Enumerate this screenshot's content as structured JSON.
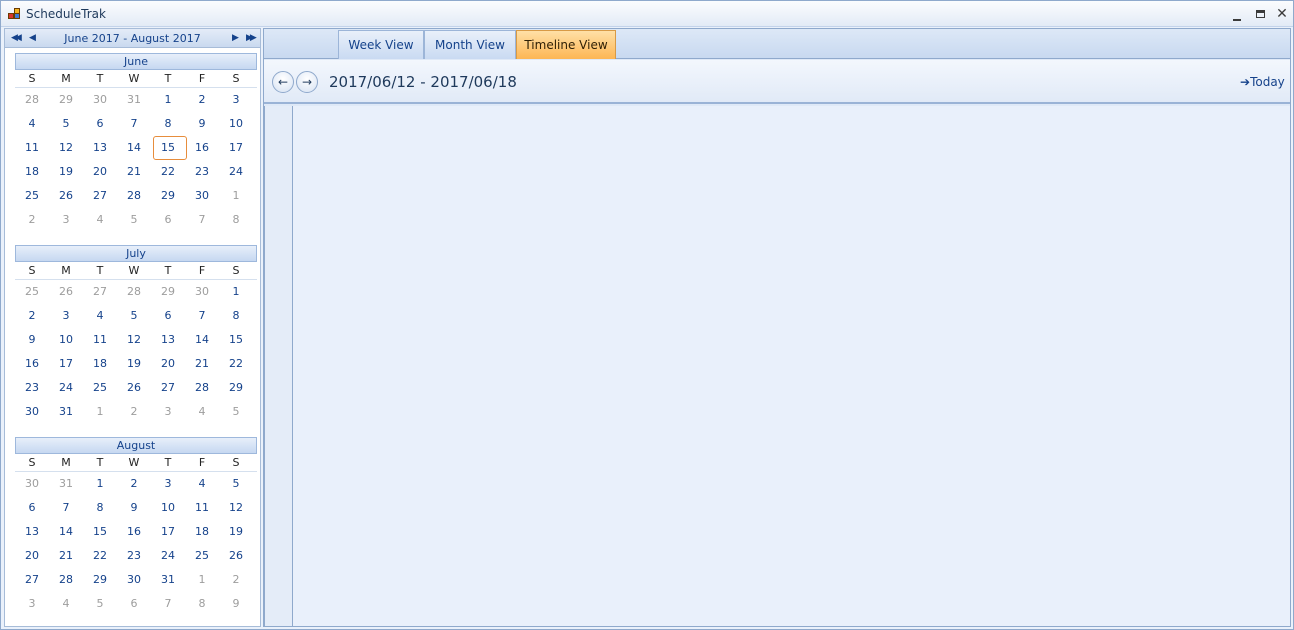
{
  "window": {
    "title": "ScheduleTrak"
  },
  "navigator": {
    "range_label": "June 2017 - August 2017",
    "weekdays": [
      "S",
      "M",
      "T",
      "W",
      "T",
      "F",
      "S"
    ],
    "months": [
      {
        "name": "June",
        "weeks": [
          [
            {
              "d": "28",
              "o": true
            },
            {
              "d": "29",
              "o": true
            },
            {
              "d": "30",
              "o": true
            },
            {
              "d": "31",
              "o": true
            },
            {
              "d": "1"
            },
            {
              "d": "2"
            },
            {
              "d": "3"
            }
          ],
          [
            {
              "d": "4"
            },
            {
              "d": "5"
            },
            {
              "d": "6"
            },
            {
              "d": "7"
            },
            {
              "d": "8"
            },
            {
              "d": "9"
            },
            {
              "d": "10"
            }
          ],
          [
            {
              "d": "11"
            },
            {
              "d": "12"
            },
            {
              "d": "13"
            },
            {
              "d": "14"
            },
            {
              "d": "15",
              "today": true
            },
            {
              "d": "16"
            },
            {
              "d": "17"
            }
          ],
          [
            {
              "d": "18"
            },
            {
              "d": "19"
            },
            {
              "d": "20"
            },
            {
              "d": "21"
            },
            {
              "d": "22"
            },
            {
              "d": "23"
            },
            {
              "d": "24"
            }
          ],
          [
            {
              "d": "25"
            },
            {
              "d": "26"
            },
            {
              "d": "27"
            },
            {
              "d": "28"
            },
            {
              "d": "29"
            },
            {
              "d": "30"
            },
            {
              "d": "1",
              "o": true
            }
          ],
          [
            {
              "d": "2",
              "o": true
            },
            {
              "d": "3",
              "o": true
            },
            {
              "d": "4",
              "o": true
            },
            {
              "d": "5",
              "o": true
            },
            {
              "d": "6",
              "o": true
            },
            {
              "d": "7",
              "o": true
            },
            {
              "d": "8",
              "o": true
            }
          ]
        ]
      },
      {
        "name": "July",
        "weeks": [
          [
            {
              "d": "25",
              "o": true
            },
            {
              "d": "26",
              "o": true
            },
            {
              "d": "27",
              "o": true
            },
            {
              "d": "28",
              "o": true
            },
            {
              "d": "29",
              "o": true
            },
            {
              "d": "30",
              "o": true
            },
            {
              "d": "1"
            }
          ],
          [
            {
              "d": "2"
            },
            {
              "d": "3"
            },
            {
              "d": "4"
            },
            {
              "d": "5"
            },
            {
              "d": "6"
            },
            {
              "d": "7"
            },
            {
              "d": "8"
            }
          ],
          [
            {
              "d": "9"
            },
            {
              "d": "10"
            },
            {
              "d": "11"
            },
            {
              "d": "12"
            },
            {
              "d": "13"
            },
            {
              "d": "14"
            },
            {
              "d": "15"
            }
          ],
          [
            {
              "d": "16"
            },
            {
              "d": "17"
            },
            {
              "d": "18"
            },
            {
              "d": "19"
            },
            {
              "d": "20"
            },
            {
              "d": "21"
            },
            {
              "d": "22"
            }
          ],
          [
            {
              "d": "23"
            },
            {
              "d": "24"
            },
            {
              "d": "25"
            },
            {
              "d": "26"
            },
            {
              "d": "27"
            },
            {
              "d": "28"
            },
            {
              "d": "29"
            }
          ],
          [
            {
              "d": "30"
            },
            {
              "d": "31"
            },
            {
              "d": "1",
              "o": true
            },
            {
              "d": "2",
              "o": true
            },
            {
              "d": "3",
              "o": true
            },
            {
              "d": "4",
              "o": true
            },
            {
              "d": "5",
              "o": true
            }
          ]
        ]
      },
      {
        "name": "August",
        "weeks": [
          [
            {
              "d": "30",
              "o": true
            },
            {
              "d": "31",
              "o": true
            },
            {
              "d": "1"
            },
            {
              "d": "2"
            },
            {
              "d": "3"
            },
            {
              "d": "4"
            },
            {
              "d": "5"
            }
          ],
          [
            {
              "d": "6"
            },
            {
              "d": "7"
            },
            {
              "d": "8"
            },
            {
              "d": "9"
            },
            {
              "d": "10"
            },
            {
              "d": "11"
            },
            {
              "d": "12"
            }
          ],
          [
            {
              "d": "13"
            },
            {
              "d": "14"
            },
            {
              "d": "15"
            },
            {
              "d": "16"
            },
            {
              "d": "17"
            },
            {
              "d": "18"
            },
            {
              "d": "19"
            }
          ],
          [
            {
              "d": "20"
            },
            {
              "d": "21"
            },
            {
              "d": "22"
            },
            {
              "d": "23"
            },
            {
              "d": "24"
            },
            {
              "d": "25"
            },
            {
              "d": "26"
            }
          ],
          [
            {
              "d": "27"
            },
            {
              "d": "28"
            },
            {
              "d": "29"
            },
            {
              "d": "30"
            },
            {
              "d": "31"
            },
            {
              "d": "1",
              "o": true
            },
            {
              "d": "2",
              "o": true
            }
          ],
          [
            {
              "d": "3",
              "o": true
            },
            {
              "d": "4",
              "o": true
            },
            {
              "d": "5",
              "o": true
            },
            {
              "d": "6",
              "o": true
            },
            {
              "d": "7",
              "o": true
            },
            {
              "d": "8",
              "o": true
            },
            {
              "d": "9",
              "o": true
            }
          ]
        ]
      }
    ]
  },
  "tabs": [
    {
      "label": "Week View",
      "active": false
    },
    {
      "label": "Month View",
      "active": false
    },
    {
      "label": "Timeline View",
      "active": true
    }
  ],
  "datebar": {
    "range": "2017/06/12 - 2017/06/18",
    "today_label": "Today"
  },
  "colors": {
    "accent": "#15428b",
    "active_tab": "#fdb654",
    "today_border": "#e78d3c"
  }
}
